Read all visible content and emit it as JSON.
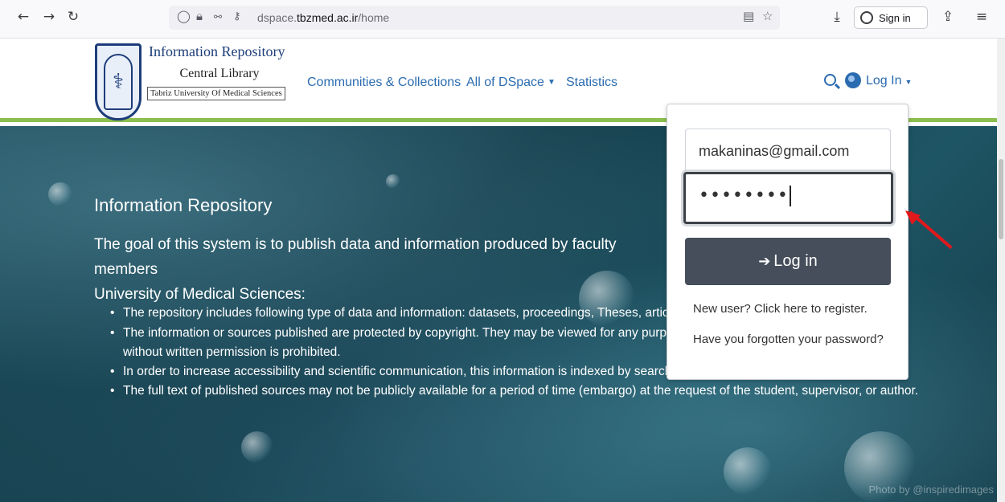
{
  "browser": {
    "url_prefix": "dspace.",
    "url_domain": "tbzmed.ac.ir",
    "url_path": "/home",
    "sign_in_label": "Sign in",
    "icons": [
      "back-icon",
      "forward-icon",
      "reload-icon",
      "shield-icon",
      "lock-icon",
      "permissions-icon",
      "key-icon",
      "reader-icon",
      "bookmark-star-icon",
      "download-icon",
      "account-icon",
      "share-icon",
      "menu-icon"
    ]
  },
  "header": {
    "logo_title": "Information Repository",
    "logo_subtitle": "Central Library",
    "logo_org": "Tabriz University Of Medical Sciences",
    "nav": {
      "communities": "Communities & Collections",
      "all_dspace": "All of DSpace",
      "statistics": "Statistics"
    },
    "login_label": "Log In",
    "accent_color": "#8cbf4f",
    "link_color": "#2b6cb0"
  },
  "hero": {
    "title": "Information Repository",
    "description": "The goal of this system is to publish data and information produced by faculty members",
    "description_cont": "University of Medical Sciences:",
    "bullets": [
      "The repository includes following type of data and information: datasets, proceedings, Theses, articles",
      "The information or sources published are protected by copyright. They may be viewed for any purpose",
      "without written permission is prohibited.",
      "In order to increase accessibility and scientific communication, this information is indexed by search engines and Google Scholar.",
      "The full text of published sources may not be publicly available for a period of time (embargo) at the request of the student, supervisor, or author."
    ],
    "photo_credit": "Photo by @inspiredimages"
  },
  "login_dropdown": {
    "email_value": "makaninas@gmail.com",
    "password_mask": "••••••••",
    "submit_label": "Log in",
    "register_link": "New user? Click here to register.",
    "forgot_link": "Have you forgotten your password?"
  }
}
